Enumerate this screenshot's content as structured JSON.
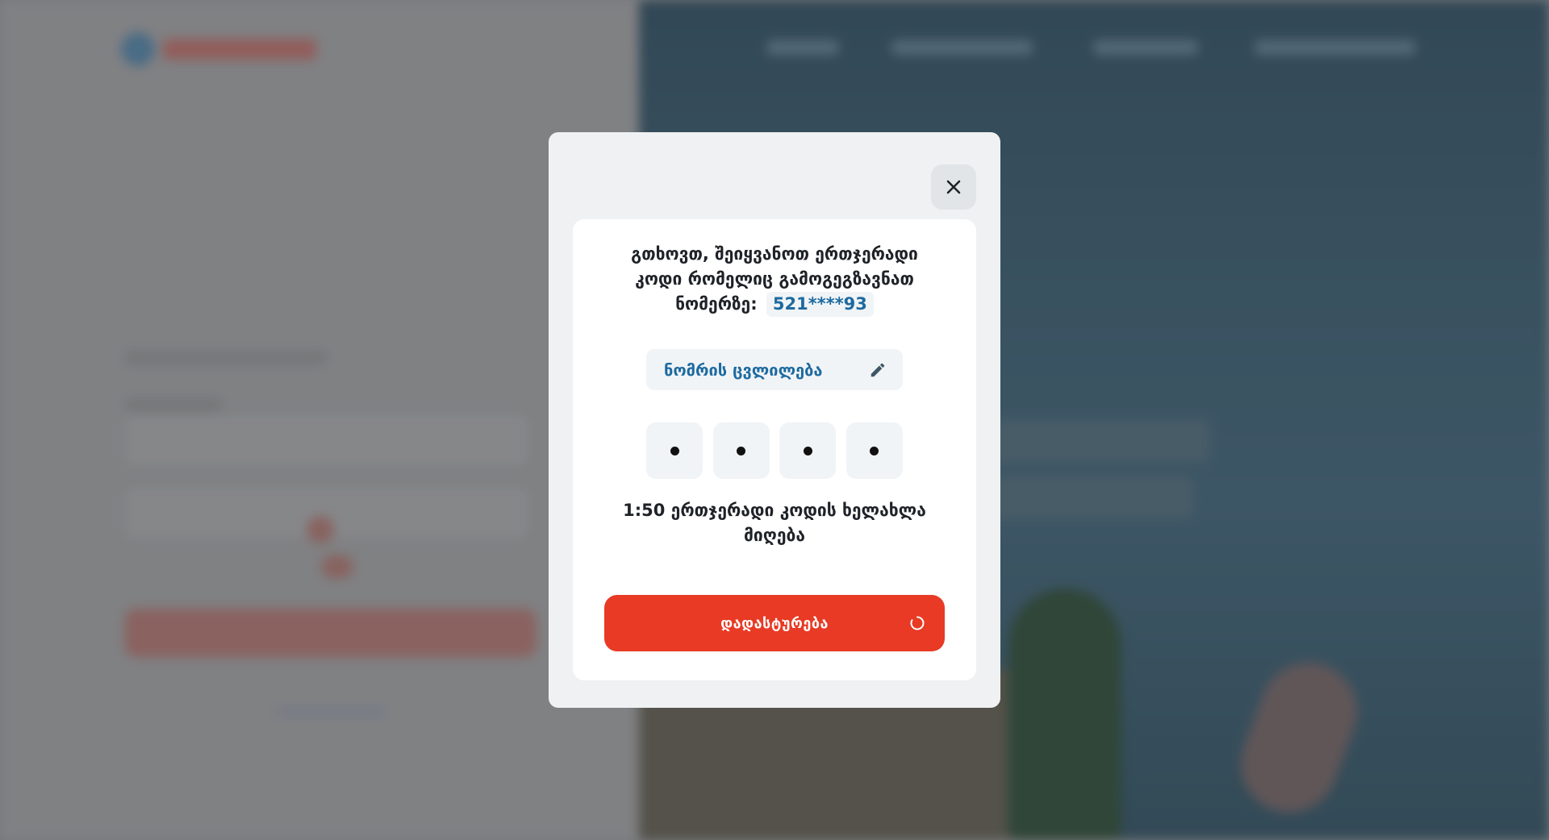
{
  "modal": {
    "message": "გთხოვთ, შეიყვანოთ ერთჯერადი კოდი რომელიც გამოგეგზავნათ ნომერზე:",
    "phone": "521****93",
    "change_number_label": "ნომრის ცვლილება",
    "otp": {
      "length": 4,
      "filled": 4,
      "masked": true
    },
    "timer_text": "1:50 ერთჯერადი კოდის ხელახლა მიღება",
    "confirm_label": "დადასტურება",
    "confirm_state": "loading",
    "icons": {
      "close": "close-icon",
      "edit": "pencil-icon",
      "loading": "spinner-icon"
    }
  },
  "colors": {
    "accent": "#e83a24",
    "link": "#1d6aa0",
    "panel": "#eff1f3"
  }
}
